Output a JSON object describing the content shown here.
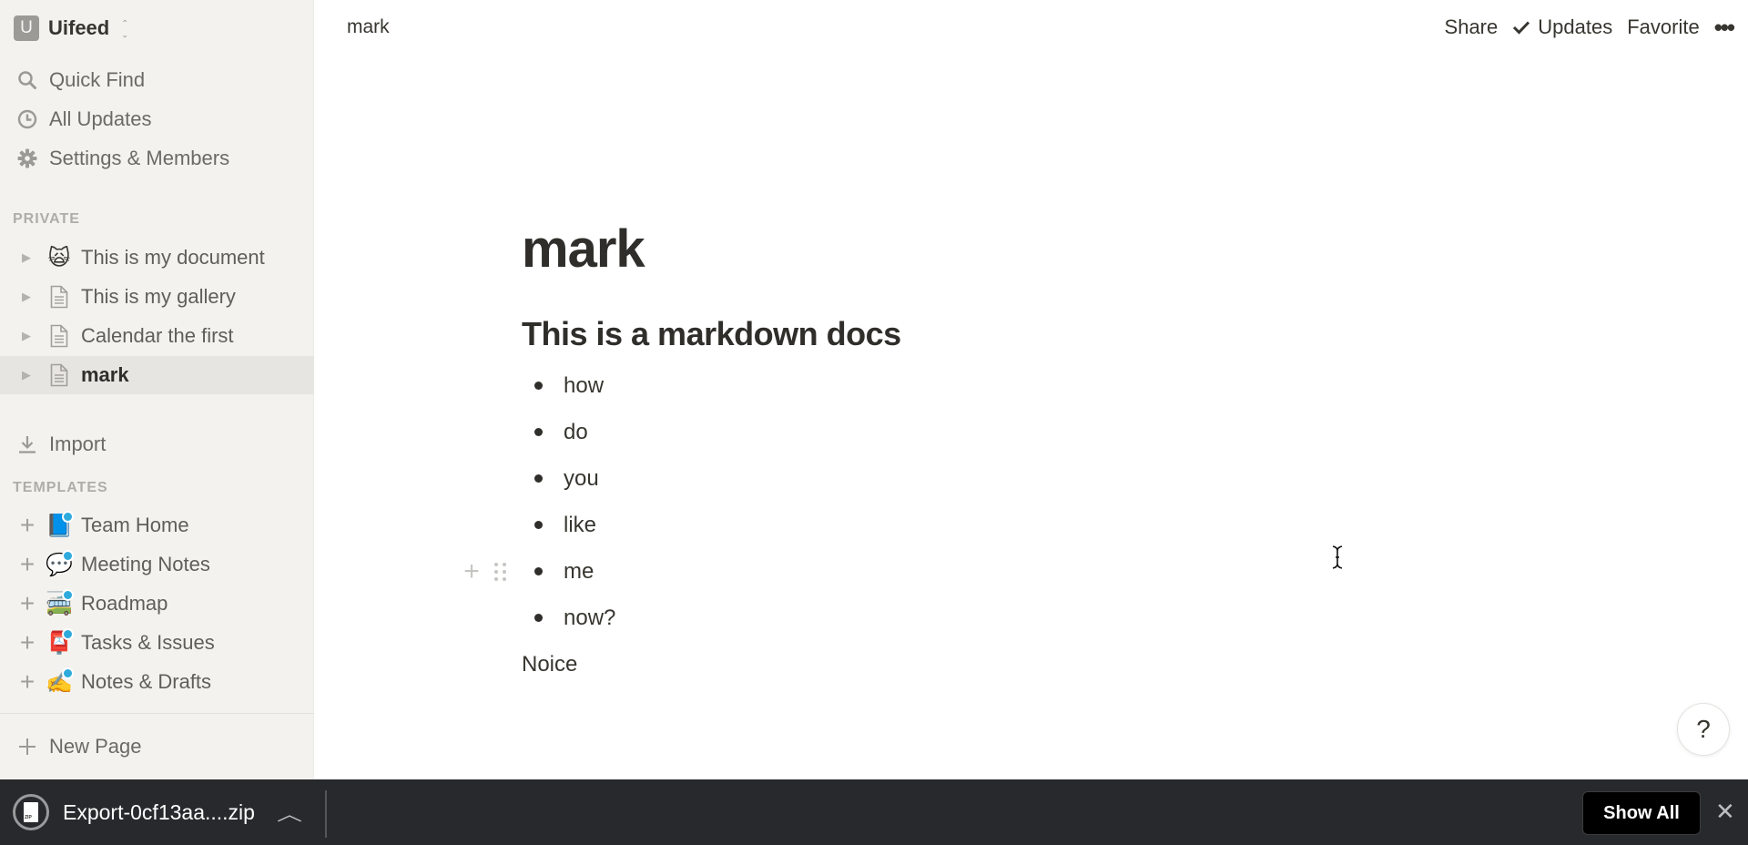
{
  "sidebar": {
    "workspace": {
      "initial": "U",
      "name": "Uifeed"
    },
    "nav": [
      {
        "label": "Quick Find",
        "icon": "search-icon"
      },
      {
        "label": "All Updates",
        "icon": "clock-icon"
      },
      {
        "label": "Settings & Members",
        "icon": "gear-icon"
      }
    ],
    "private_label": "PRIVATE",
    "pages": [
      {
        "label": "This is my document",
        "icon": "🙀"
      },
      {
        "label": "This is my gallery",
        "icon": "page-icon"
      },
      {
        "label": "Calendar the first",
        "icon": "page-icon"
      },
      {
        "label": "mark",
        "icon": "page-icon",
        "active": true
      }
    ],
    "import_label": "Import",
    "templates_label": "TEMPLATES",
    "templates": [
      {
        "label": "Team Home",
        "icon": "📘"
      },
      {
        "label": "Meeting Notes",
        "icon": "💬"
      },
      {
        "label": "Roadmap",
        "icon": "🚎"
      },
      {
        "label": "Tasks & Issues",
        "icon": "📮"
      },
      {
        "label": "Notes & Drafts",
        "icon": "✍️"
      }
    ],
    "new_page_label": "New Page"
  },
  "topbar": {
    "breadcrumb": "mark",
    "share_label": "Share",
    "updates_label": "Updates",
    "favorite_label": "Favorite",
    "more_label": "•••"
  },
  "document": {
    "title": "mark",
    "heading": "This is a markdown docs",
    "bullets": [
      "how",
      "do",
      "you",
      "like",
      "me",
      "now?"
    ],
    "paragraph": "Noice"
  },
  "help_label": "?",
  "download_bar": {
    "file_name": "Export-0cf13aa....zip",
    "show_all_label": "Show All",
    "close_label": "✕"
  }
}
